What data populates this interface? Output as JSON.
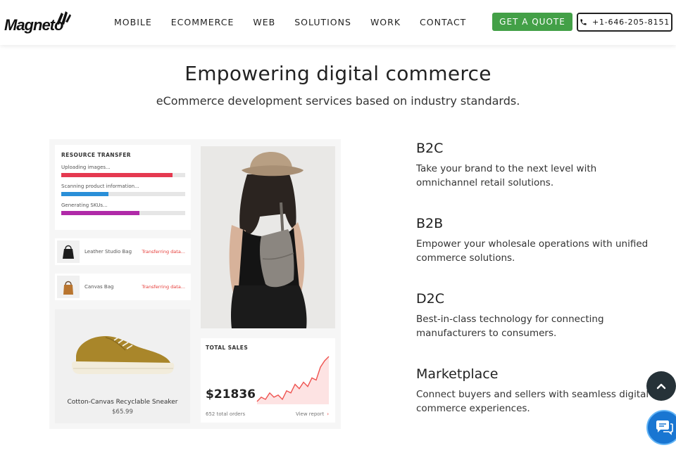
{
  "brand": {
    "name": "Magneto"
  },
  "nav": {
    "items": [
      {
        "label": "MOBILE"
      },
      {
        "label": "ECOMMERCE"
      },
      {
        "label": "WEB"
      },
      {
        "label": "SOLUTIONS"
      },
      {
        "label": "WORK"
      },
      {
        "label": "CONTACT"
      }
    ],
    "quote_label": "GET A QUOTE",
    "phone": "+1-646-205-8151"
  },
  "hero": {
    "title": "Empowering digital commerce",
    "subtitle": "eCommerce development services based on industry standards."
  },
  "illustration": {
    "resource_transfer": {
      "title": "RESOURCE TRANSFER",
      "tasks": [
        {
          "label": "Uploading images...",
          "progress": 0.9,
          "color": "#e53950"
        },
        {
          "label": "Scanning product information...",
          "progress": 0.38,
          "color": "#2a8fd8"
        },
        {
          "label": "Generating SKUs...",
          "progress": 0.63,
          "color": "#b02aa8"
        }
      ]
    },
    "transfers": [
      {
        "name": "Leather Studio Bag",
        "status": "Transferring data..."
      },
      {
        "name": "Canvas Bag",
        "status": "Transferring data..."
      }
    ],
    "product": {
      "name": "Cotton-Canvas Recyclable Sneaker",
      "price": "$65.99"
    },
    "sales": {
      "title": "TOTAL SALES",
      "amount": "$21836",
      "orders": "652 total orders",
      "link": "View report",
      "trend": [
        3,
        5,
        4,
        7,
        5,
        6,
        4,
        8,
        7,
        11,
        9,
        12,
        10,
        14,
        13,
        19,
        22,
        24
      ]
    }
  },
  "features": [
    {
      "title": "B2C",
      "text": "Take your brand to the next level with omnichannel retail solutions."
    },
    {
      "title": "B2B",
      "text": "Empower your wholesale operations with unified commerce solutions."
    },
    {
      "title": "D2C",
      "text": "Best-in-class technology for connecting manufacturers to consumers."
    },
    {
      "title": "Marketplace",
      "text": "Connect buyers and sellers with seamless digital commerce experiences."
    }
  ],
  "colors": {
    "accent_green": "#43a047",
    "dark": "#263238",
    "chat_blue": "#1976d2"
  }
}
